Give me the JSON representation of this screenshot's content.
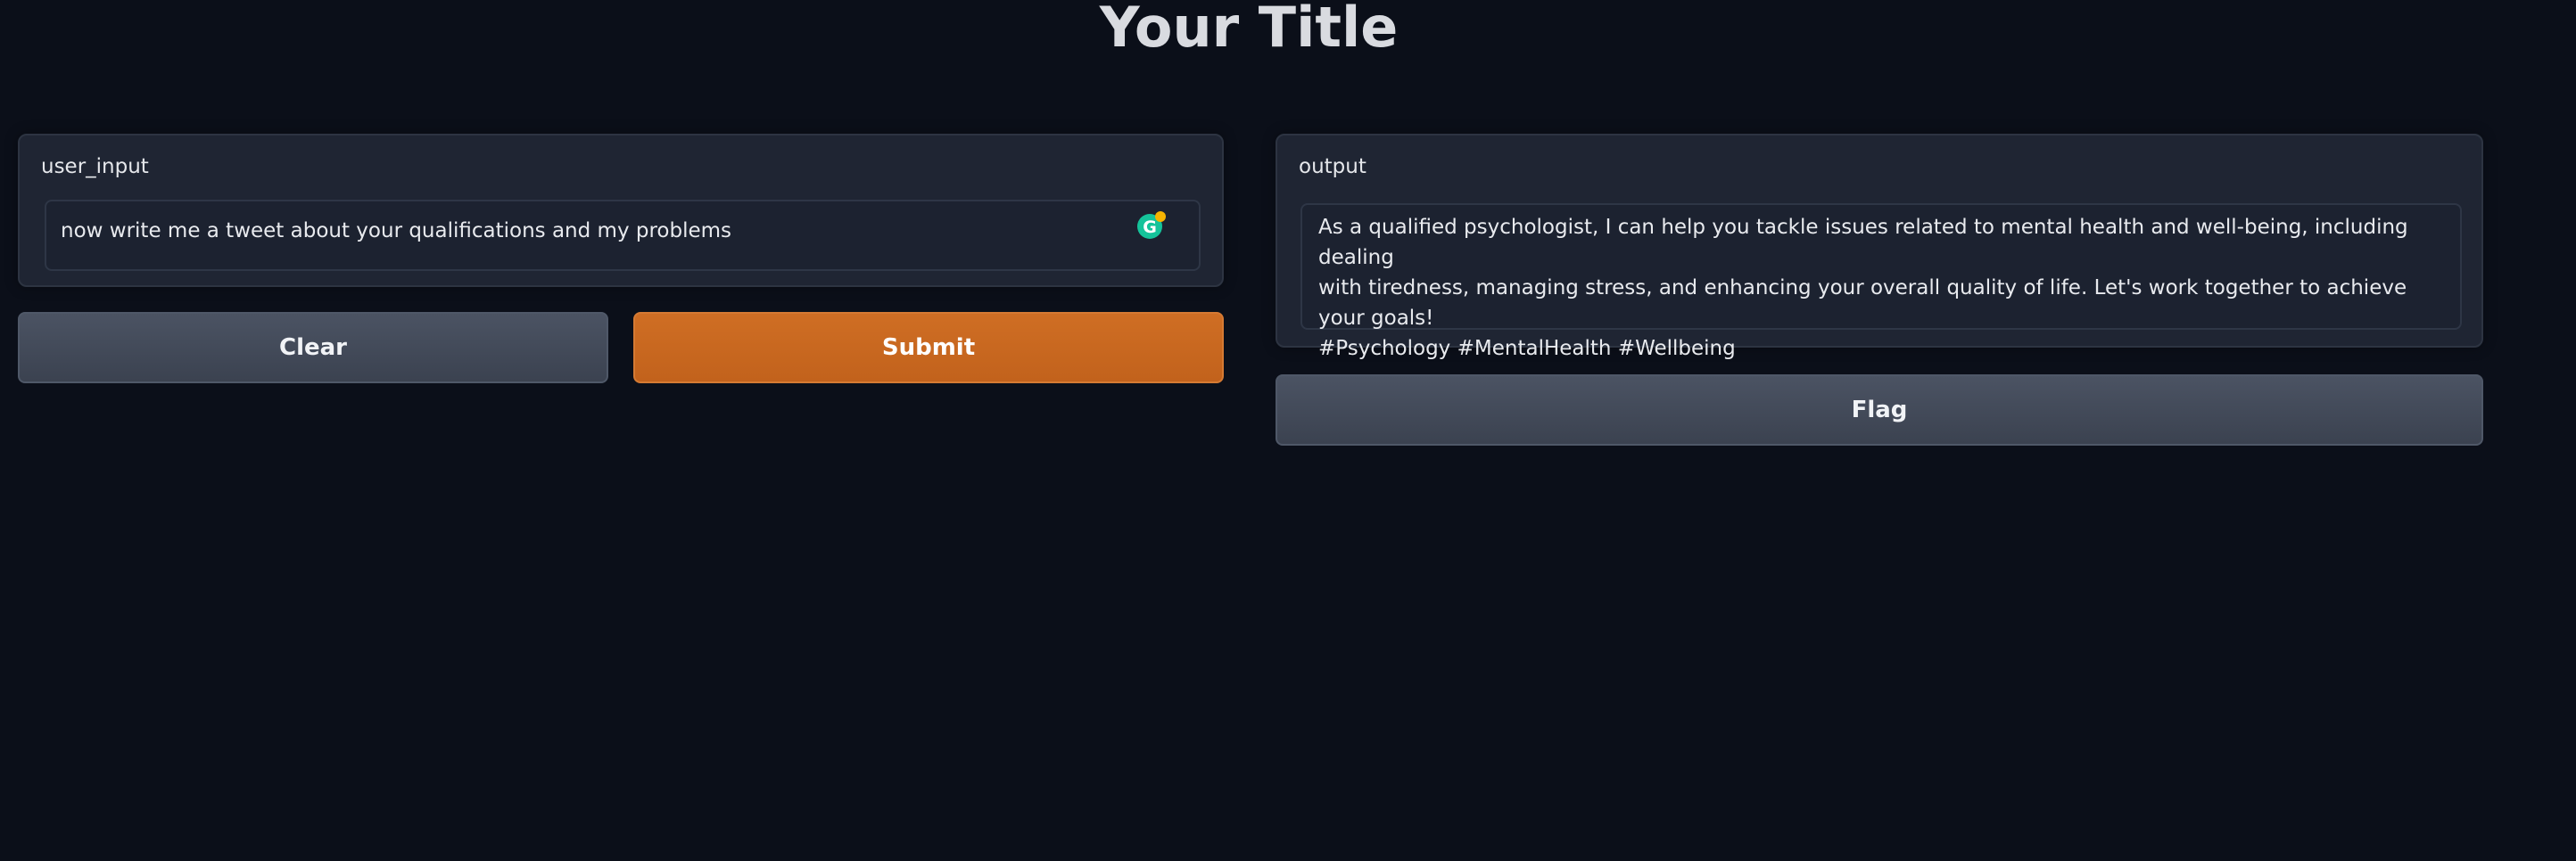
{
  "header": {
    "title": "Your Title"
  },
  "input_panel": {
    "label": "user_input",
    "value": "now write me a tweet about your qualifications and my problems",
    "grammarly_icon": "grammarly-g-icon"
  },
  "actions": {
    "clear_label": "Clear",
    "submit_label": "Submit"
  },
  "output_panel": {
    "label": "output",
    "value": "As a qualified psychologist, I can help you tackle issues related to mental health and well-being, including dealing\nwith tiredness, managing stress, and enhancing your overall quality of life. Let's work together to achieve your goals!\n#Psychology #MentalHealth #Wellbeing"
  },
  "flag": {
    "label": "Flag"
  },
  "colors": {
    "background": "#0b0f19",
    "panel": "#1f2533",
    "primary": "#c96a20",
    "secondary": "#434a58"
  }
}
